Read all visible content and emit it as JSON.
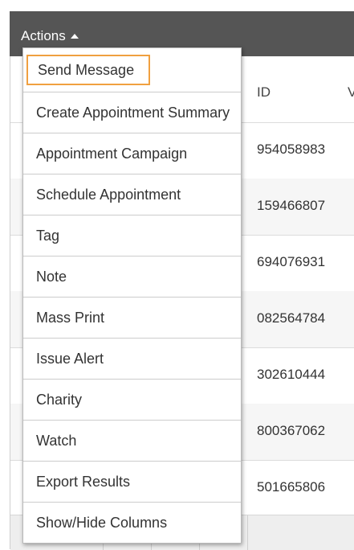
{
  "toolbar": {
    "actions_label": "Actions"
  },
  "table": {
    "columns": {
      "id": "ID",
      "next_partial": "V"
    },
    "rows": [
      {
        "id": "954058983"
      },
      {
        "id": "159466807"
      },
      {
        "id": "694076931"
      },
      {
        "id": "082564784"
      },
      {
        "id": "302610444"
      },
      {
        "id": "800367062"
      },
      {
        "id": "501665806"
      }
    ]
  },
  "menu": {
    "items": [
      {
        "label": "Send Message",
        "highlighted": true
      },
      {
        "label": "Create Appointment Summary"
      },
      {
        "label": "Appointment Campaign"
      },
      {
        "label": "Schedule Appointment"
      },
      {
        "label": "Tag"
      },
      {
        "label": "Note"
      },
      {
        "label": "Mass Print"
      },
      {
        "label": "Issue Alert"
      },
      {
        "label": "Charity"
      },
      {
        "label": "Watch"
      },
      {
        "label": "Export Results"
      },
      {
        "label": "Show/Hide Columns"
      }
    ]
  },
  "colors": {
    "highlight": "#f0a040",
    "topbar": "#555555"
  }
}
